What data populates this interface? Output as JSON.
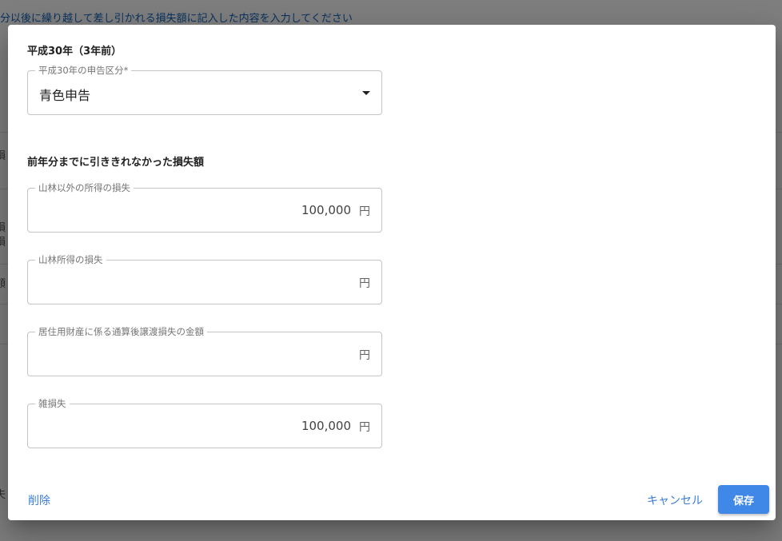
{
  "background": {
    "header_text": "分以後に繰り越して差し引かれる損失額に記入した内容を入力してください",
    "fragments": [
      "損",
      "損",
      "損",
      "額",
      "夫"
    ]
  },
  "dialog": {
    "year_heading": "平成30年（3年前）",
    "filing_type": {
      "label": "平成30年の申告区分*",
      "value": "青色申告"
    },
    "loss_heading": "前年分までに引ききれなかった損失額",
    "fields": [
      {
        "label": "山林以外の所得の損失",
        "value": "100,000",
        "unit": "円"
      },
      {
        "label": "山林所得の損失",
        "value": "",
        "unit": "円"
      },
      {
        "label": "居住用財産に係る通算後譲渡損失の金額",
        "value": "",
        "unit": "円"
      },
      {
        "label": "雑損失",
        "value": "100,000",
        "unit": "円"
      }
    ],
    "actions": {
      "delete": "削除",
      "cancel": "キャンセル",
      "save": "保存"
    }
  },
  "colors": {
    "accent": "#3f88e8",
    "link": "#3b7dd8"
  }
}
